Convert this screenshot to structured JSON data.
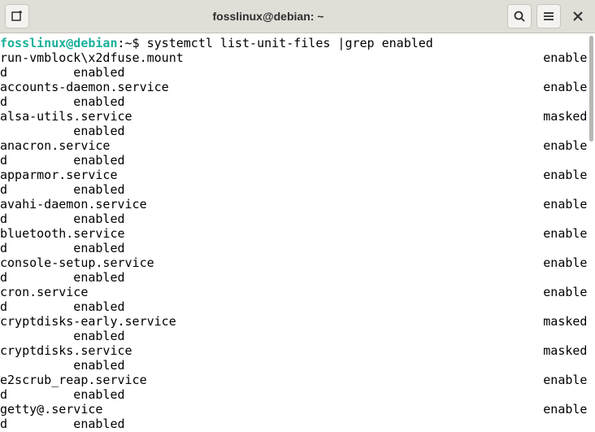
{
  "titlebar": {
    "title": "fosslinux@debian: ~"
  },
  "prompt": {
    "user_host": "fosslinux@debian",
    "sep": ":",
    "path": "~",
    "symbol": "$",
    "command": "systemctl list-unit-files |grep enabled"
  },
  "rows": [
    {
      "unit": "run-vmblock\\x2dfuse.mount",
      "state": "enabled",
      "preset": "enabled"
    },
    {
      "unit": "accounts-daemon.service",
      "state": "enabled",
      "preset": "enabled"
    },
    {
      "unit": "alsa-utils.service",
      "state": "masked",
      "preset": "enabled"
    },
    {
      "unit": "anacron.service",
      "state": "enabled",
      "preset": "enabled"
    },
    {
      "unit": "apparmor.service",
      "state": "enabled",
      "preset": "enabled"
    },
    {
      "unit": "avahi-daemon.service",
      "state": "enabled",
      "preset": "enabled"
    },
    {
      "unit": "bluetooth.service",
      "state": "enabled",
      "preset": "enabled"
    },
    {
      "unit": "console-setup.service",
      "state": "enabled",
      "preset": "enabled"
    },
    {
      "unit": "cron.service",
      "state": "enabled",
      "preset": "enabled"
    },
    {
      "unit": "cryptdisks-early.service",
      "state": "masked",
      "preset": "enabled"
    },
    {
      "unit": "cryptdisks.service",
      "state": "masked",
      "preset": "enabled"
    },
    {
      "unit": "e2scrub_reap.service",
      "state": "enabled",
      "preset": "enabled"
    },
    {
      "unit": "getty@.service",
      "state": "enabled",
      "preset": "enabled"
    }
  ],
  "layout": {
    "col_state": 74,
    "col_preset": 90,
    "width": 80
  }
}
